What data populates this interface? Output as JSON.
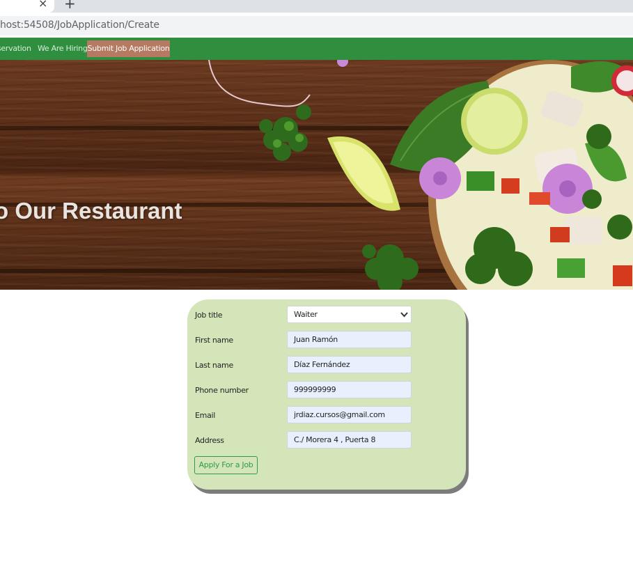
{
  "browser": {
    "close_tab_glyph": "×",
    "new_tab_glyph": "+",
    "url": "host:54508/JobApplication/Create"
  },
  "navbar": {
    "links": [
      {
        "label": "servation"
      },
      {
        "label": "We Are Hiring"
      },
      {
        "label": "Submit Job Application",
        "active": true
      }
    ],
    "bg_color": "#2f8f3f",
    "active_color": "#b67a63"
  },
  "hero": {
    "title": "o Our Restaurant"
  },
  "form": {
    "job_title": {
      "label": "Job title",
      "value": "Waiter"
    },
    "first_name": {
      "label": "First name",
      "value": "Juan Ramón"
    },
    "last_name": {
      "label": "Last name",
      "value": "Díaz Fernández"
    },
    "phone": {
      "label": "Phone number",
      "value": "999999999"
    },
    "email": {
      "label": "Email",
      "value": "jrdiaz.cursos@gmail.com"
    },
    "address": {
      "label": "Address",
      "value": "C./ Morera 4 , Puerta 8"
    },
    "submit_label": "Apply For a Job",
    "card_color": "#d3e5b9",
    "button_color": "#2e9b47"
  }
}
